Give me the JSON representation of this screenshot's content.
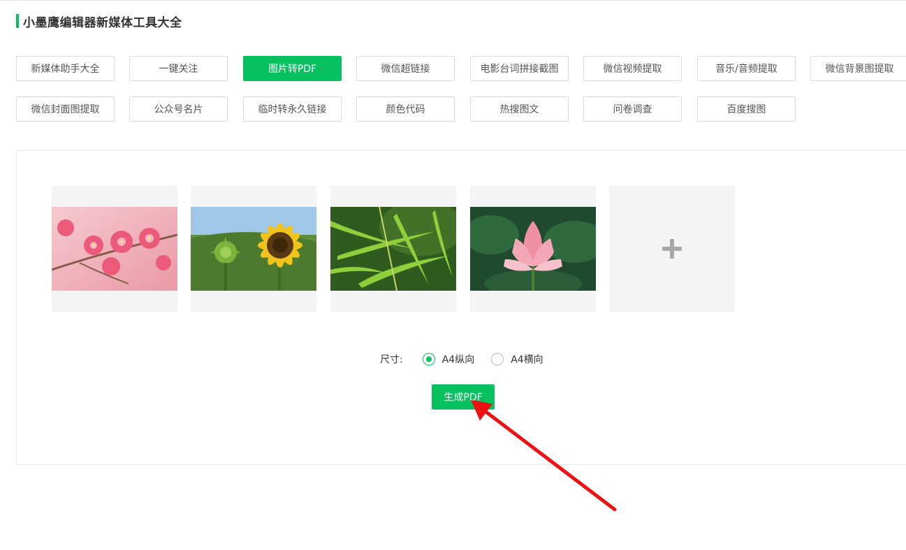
{
  "page": {
    "title": "小墨鹰编辑器新媒体工具大全",
    "accent_color": "#07c160"
  },
  "tools": [
    {
      "label": "新媒体助手大全",
      "active": false
    },
    {
      "label": "一键关注",
      "active": false
    },
    {
      "label": "图片转PDF",
      "active": true
    },
    {
      "label": "微信超链接",
      "active": false
    },
    {
      "label": "电影台词拼接截图",
      "active": false
    },
    {
      "label": "微信视频提取",
      "active": false
    },
    {
      "label": "音乐/音频提取",
      "active": false
    },
    {
      "label": "微信背景图提取",
      "active": false
    },
    {
      "label": "微信封面图提取",
      "active": false
    },
    {
      "label": "公众号名片",
      "active": false
    },
    {
      "label": "临时转永久链接",
      "active": false
    },
    {
      "label": "颜色代码",
      "active": false
    },
    {
      "label": "热搜图文",
      "active": false
    },
    {
      "label": "问卷调查",
      "active": false
    },
    {
      "label": "百度搜图",
      "active": false
    }
  ],
  "images": [
    {
      "subject": "plum-blossom"
    },
    {
      "subject": "sunflower"
    },
    {
      "subject": "bamboo-leaves"
    },
    {
      "subject": "lotus"
    }
  ],
  "add_icon": "plus-icon",
  "size": {
    "label": "尺寸:",
    "options": [
      {
        "label": "A4纵向",
        "selected": true
      },
      {
        "label": "A4横向",
        "selected": false
      }
    ]
  },
  "generate_label": "生成PDF",
  "annotation": {
    "arrow_color": "#ee1111"
  }
}
